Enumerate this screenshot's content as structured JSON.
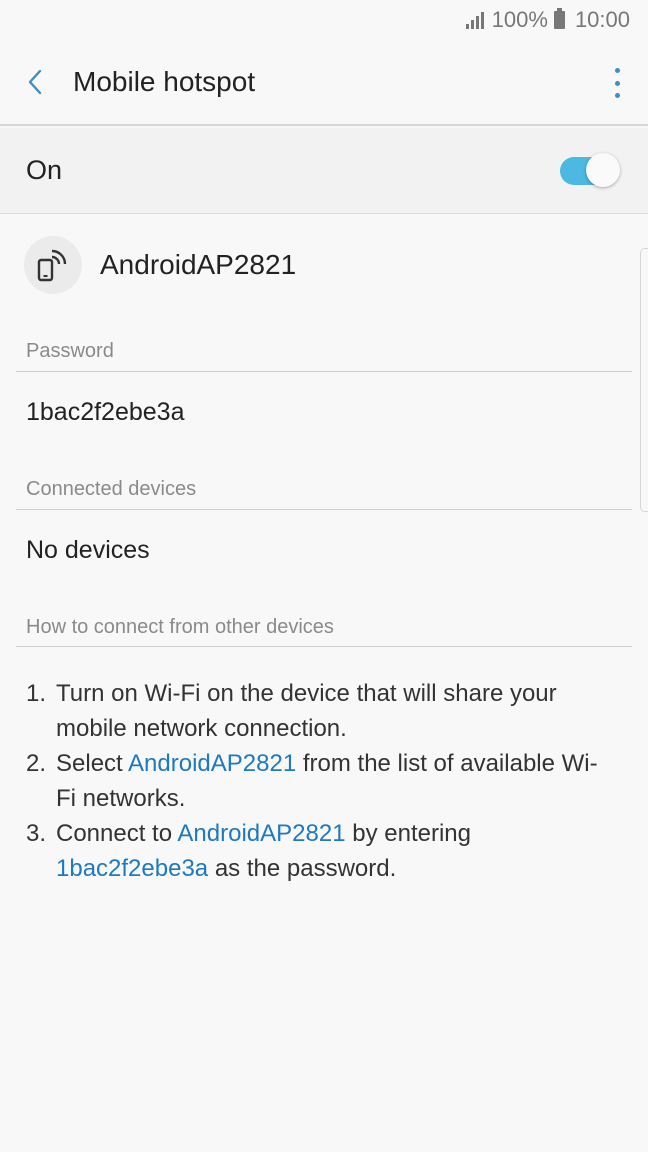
{
  "status_bar": {
    "battery_text": "100%",
    "time": "10:00",
    "icons": [
      "signal-icon",
      "battery-icon"
    ]
  },
  "header": {
    "title": "Mobile hotspot",
    "back_icon": "chevron-left-icon",
    "menu_icon": "more-vert-icon"
  },
  "master_switch": {
    "label": "On",
    "checked": true,
    "accent": "#4db8e2"
  },
  "network": {
    "icon": "hotspot-icon",
    "name": "AndroidAP2821"
  },
  "password_section": {
    "label": "Password",
    "value": "1bac2f2ebe3a"
  },
  "devices_section": {
    "label": "Connected devices",
    "value": "No devices"
  },
  "help_section": {
    "label": "How to connect from other devices",
    "steps": [
      {
        "num": "1.",
        "text": "Turn on Wi-Fi on the device that will share your mobile network connection."
      },
      {
        "num": "2.",
        "pre": "Select ",
        "link": "AndroidAP2821",
        "post": " from the list of available Wi-Fi networks."
      },
      {
        "num": "3.",
        "pre": "Connect to ",
        "link": "AndroidAP2821",
        "mid": " by entering ",
        "link2": "1bac2f2ebe3a",
        "post": " as the password."
      }
    ]
  },
  "colors": {
    "link": "#1e79c1",
    "back_icon": "#3d8fc4"
  }
}
